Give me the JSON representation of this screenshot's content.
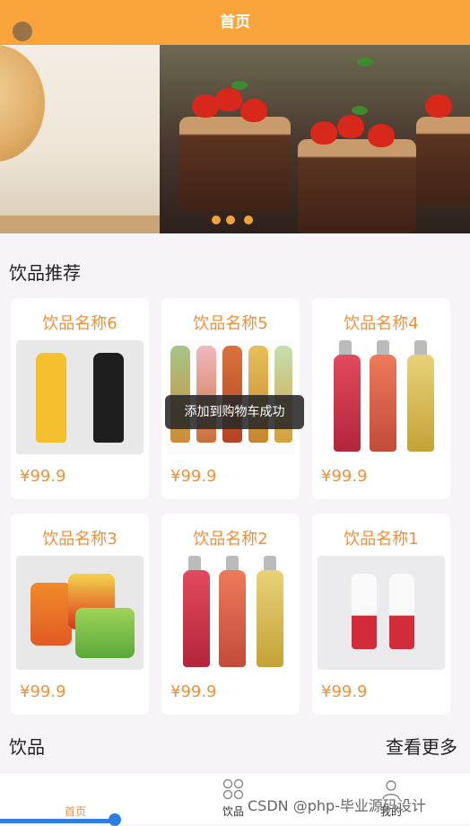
{
  "header": {
    "title": "首页"
  },
  "sections": {
    "recommend_title": "饮品推荐",
    "drinks_title": "饮品",
    "more_label": "查看更多"
  },
  "products": [
    {
      "name": "饮品名称6",
      "price": "¥99.9",
      "image": "jamaica-blue-mountain-bottles"
    },
    {
      "name": "饮品名称5",
      "price": "¥99.9",
      "image": "tea-bottles-row"
    },
    {
      "name": "饮品名称4",
      "price": "¥99.9",
      "image": "fruit-juice-bottles"
    },
    {
      "name": "饮品名称3",
      "price": "¥99.9",
      "image": "soda-cans"
    },
    {
      "name": "饮品名称2",
      "price": "¥99.9",
      "image": "fruit-juice-bottles"
    },
    {
      "name": "饮品名称1",
      "price": "¥99.9",
      "image": "white-red-bottles"
    }
  ],
  "toast": {
    "text": "添加到购物车成功"
  },
  "tabbar": [
    {
      "label": "首页",
      "icon": "home-icon",
      "active": true
    },
    {
      "label": "饮品",
      "icon": "grid-icon",
      "active": false
    },
    {
      "label": "我的",
      "icon": "user-icon",
      "active": false
    }
  ],
  "watermark": "CSDN @php-毕业源码设计",
  "colors": {
    "accent": "#f9a43a",
    "price": "#f0903a"
  }
}
